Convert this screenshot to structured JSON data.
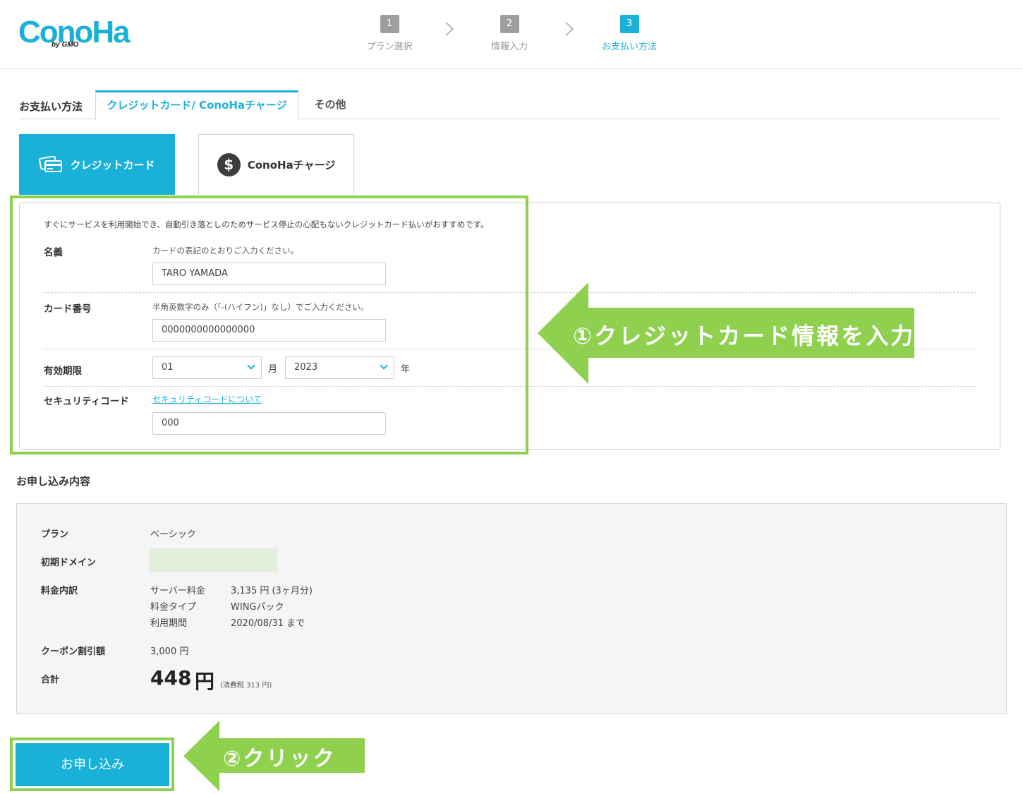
{
  "header": {
    "logo_text": "ConoHa",
    "logo_sub": "by GMO",
    "steps": [
      {
        "num": "1",
        "label": "プラン選択"
      },
      {
        "num": "2",
        "label": "情報入力"
      },
      {
        "num": "3",
        "label": "お支払い方法"
      }
    ]
  },
  "payment": {
    "section_title": "お支払い方法",
    "tabs": [
      "クレジットカード/ ConoHaチャージ",
      "その他"
    ],
    "methods": [
      {
        "label": "クレジットカード",
        "icon": "credit-card-icon"
      },
      {
        "label": "ConoHaチャージ",
        "icon": "dollar-coin-icon",
        "icon_glyph": "$"
      }
    ],
    "intro": "すぐにサービスを利用開始でき、自動引き落としのためサービス停止の心配もないクレジットカード払いがおすすめです。",
    "name": {
      "label": "名義",
      "hint": "カードの表記のとおりご入力ください。",
      "value": "TARO YAMADA"
    },
    "card_number": {
      "label": "カード番号",
      "hint": "半角英数字のみ（「-(ハイフン)」なし）でご入力ください。",
      "value": "0000000000000000"
    },
    "expiry": {
      "label": "有効期限",
      "month": "01",
      "month_unit": "月",
      "year": "2023",
      "year_unit": "年"
    },
    "security": {
      "label": "セキュリティコード",
      "link": "セキュリティコードについて",
      "value": "000"
    }
  },
  "summary": {
    "title": "お申し込み内容",
    "plan": {
      "label": "プラン",
      "value": "ベーシック"
    },
    "domain": {
      "label": "初期ドメイン"
    },
    "breakdown": {
      "label": "料金内訳",
      "rows": [
        {
          "name": "サーバー料金",
          "value": "3,135 円 (3ヶ月分)"
        },
        {
          "name": "料金タイプ",
          "value": "WINGパック"
        },
        {
          "name": "利用期間",
          "value": "2020/08/31 まで"
        }
      ]
    },
    "coupon": {
      "label": "クーポン割引額",
      "value": "3,000 円"
    },
    "total": {
      "label": "合計",
      "amount": "448",
      "unit": "円",
      "tax": "(消費税 313 円)"
    }
  },
  "submit_label": "お申し込み",
  "annotations": {
    "step1": "①クレジットカード情報を入力",
    "step2": "②クリック",
    "color": "#8fd14f"
  },
  "colors": {
    "accent": "#1ab1d9",
    "annotation": "#8fd14f"
  }
}
